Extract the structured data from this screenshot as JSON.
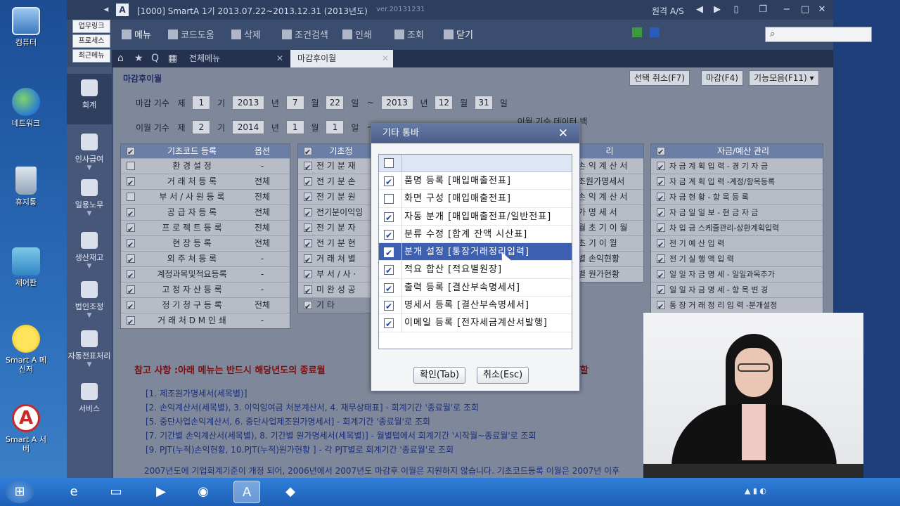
{
  "desktop": {
    "icons": [
      {
        "label": "컴퓨터"
      },
      {
        "label": "네트워크"
      },
      {
        "label": "휴지통"
      },
      {
        "label": "제어판"
      },
      {
        "label": "Smart A 메신저"
      },
      {
        "label": "Smart A 서버"
      }
    ]
  },
  "window": {
    "logo": "A",
    "title": "[1000] SmartA    1기 2013.07.22~2013.12.31 (2013년도)",
    "version": "ver.20131231",
    "remote_as": "원격 A/S"
  },
  "left_buttons": [
    "업무링크",
    "프로세스",
    "최근메뉴"
  ],
  "left_nav": [
    {
      "label": "회계"
    },
    {
      "label": "인사급여"
    },
    {
      "label": "일용노무"
    },
    {
      "label": "생산재고"
    },
    {
      "label": "법인조정"
    },
    {
      "label": "자동전표처리"
    },
    {
      "label": "서비스"
    }
  ],
  "toolbar": {
    "menu": "메뉴",
    "code_help": "코드도움",
    "delete": "삭제",
    "condition_search": "조건검색",
    "print": "인쇄",
    "view": "조회",
    "close": "닫기"
  },
  "tabs": {
    "all_menu": "전체메뉴",
    "active": "마감후이월"
  },
  "page": {
    "title": "마감후이월",
    "cancel_selection": "선택 취소(F7)",
    "close_btn": "마감(F4)",
    "functions": "기능모음(F11)",
    "close_period": {
      "label": "마감 기수",
      "je": "제",
      "period": "1",
      "gi": "기",
      "from_year": "2013",
      "year_unit": "년",
      "from_month": "7",
      "month_unit": "월",
      "from_day": "22",
      "day_unit": "일",
      "tilde": "~",
      "to_year": "2013",
      "to_month": "12",
      "to_day": "31"
    },
    "carry_period": {
      "label": "이월 기수",
      "je": "제",
      "period": "2",
      "gi": "기",
      "from_year": "2014",
      "year_unit": "년",
      "from_month": "1",
      "month_unit": "월",
      "from_day": "1",
      "day_unit": "일",
      "tilde": "~",
      "backup": "이월 기수 데이터 백업"
    }
  },
  "grid_basic": {
    "header_code": "기초코드 등록",
    "header_option": "옵션",
    "rows": [
      {
        "name": "환 경 설 정",
        "option": "-",
        "checked": false
      },
      {
        "name": "거 래 처 등 록",
        "option": "전체",
        "checked": true
      },
      {
        "name": "부 서 / 사 원 등 록",
        "option": "전체",
        "checked": false
      },
      {
        "name": "공 급 자 등 록",
        "option": "전체",
        "checked": true
      },
      {
        "name": "프 로 젝 트 등 록",
        "option": "전체",
        "checked": true
      },
      {
        "name": "현 장 등 록",
        "option": "전체",
        "checked": true
      },
      {
        "name": "외 주 처 등 록",
        "option": "-",
        "checked": true
      },
      {
        "name": "계정과목및적요등록",
        "option": "-",
        "checked": true
      },
      {
        "name": "고 정 자 산 등 록",
        "option": "-",
        "checked": true
      },
      {
        "name": "정 기 청 구 등 록",
        "option": "전체",
        "checked": true
      },
      {
        "name": "거 래 처 D M 인 쇄",
        "option": "-",
        "checked": true
      }
    ]
  },
  "grid_second": {
    "header": "기초정",
    "rows": [
      "전 기 분 재",
      "전 기 분 손",
      "전 기 분 원",
      "전기분이익잉",
      "전 기 분 자",
      "전 기 분 현",
      "거 래 처 별",
      "부 서 / 사 ·",
      "미 완 성 공",
      "기 타"
    ],
    "checked": [
      true,
      true,
      true,
      true,
      true,
      true,
      true,
      true,
      true,
      true
    ]
  },
  "grid_third": {
    "header": "리",
    "rows": [
      "손 익 계 산 서",
      "조원가명세서",
      "손 익 계 산 서",
      "가 명 세 서",
      "월 초 기 이 월",
      "초 기 이 월",
      "별 손익현황",
      "별 원가현황"
    ]
  },
  "grid_fund": {
    "header": "자금/예산 관리",
    "rows": [
      {
        "name": "자 금 계 획 입 력 - 경 기 자 금",
        "checked": true
      },
      {
        "name": "자 금 계 획 입 력 -계정/항목등록",
        "checked": true
      },
      {
        "name": "자 금 현 황 - 항 목 등 록",
        "checked": true
      },
      {
        "name": "자 금 일 일 보 - 현 금 자 금",
        "checked": true
      },
      {
        "name": "차 입 금 스케줄관리-상환계획입력",
        "checked": true
      },
      {
        "name": "전 기 예 산 입 력",
        "checked": true
      },
      {
        "name": "전 기 실 행 액 입 력",
        "checked": true
      },
      {
        "name": "일 일 자 금 명 세 - 일일과목추가",
        "checked": true
      },
      {
        "name": "일 일 자 금 명 세 - 항 목 변 경",
        "checked": true
      },
      {
        "name": "통 장 거 래 정 리 입 력 -분개설정",
        "checked": true
      }
    ]
  },
  "notice": {
    "head": "참고 사항 :아래 메뉴는 반드시 해당년도의 종료월",
    "tail": "월을 이월할",
    "lines": [
      "[1. 제조원가명세서(세목별)]",
      "[2. 손익계산서(세목별), 3. 이익잉여금 처분계산서, 4. 재무상태표] - 회계기간 '종료월'로 조회",
      "[5. 중단사업손익계산서, 6. 중단사업제조원가명세서] - 회계기간 '종료월'로 조회",
      "[7. 기간별 손익계산서(세목별), 8. 기간별 원가명세서(세목별)] - 월별탭에서 회계기간 '시작월~종료월'로 조회",
      "[9. PJT(누적)손익현황, 10.PJT(누적)원가현황 ] - 각 PJT별로 회계기간 '종료월'로 조회",
      "2007년도에 기업회계기준이 개정 되어, 2006년에서 2007년도 마감후 이월은 지원하지 않습니다. 기초코드등록 이월은 2007년 이후"
    ]
  },
  "dialog": {
    "title": "기타 통바",
    "items": [
      {
        "label": "품명 등록 [매입매출전표]",
        "checked": true,
        "selected": false
      },
      {
        "label": "화면 구성 [매입매출전표]",
        "checked": false,
        "selected": false
      },
      {
        "label": "자동 분개 [매입매출전표/일반전표]",
        "checked": true,
        "selected": false
      },
      {
        "label": "분류 수정 [합계 잔액 시산표]",
        "checked": true,
        "selected": false
      },
      {
        "label": "분개 설정 [통장거래정리입력]",
        "checked": true,
        "selected": true
      },
      {
        "label": "적요 합산 [적요별원장]",
        "checked": true,
        "selected": false
      },
      {
        "label": "출력 등록 [결산부속명세서]",
        "checked": true,
        "selected": false
      },
      {
        "label": "명세서 등록 [결산부속명세서]",
        "checked": true,
        "selected": false
      },
      {
        "label": "이메일 등록 [전자세금계산서발행]",
        "checked": true,
        "selected": false
      }
    ],
    "ok": "확인(Tab)",
    "cancel": "취소(Esc)"
  },
  "colors": {
    "accent": "#3d60b3",
    "grid_header": "#6b7fa6",
    "taskbar": "#2f7ed8"
  }
}
